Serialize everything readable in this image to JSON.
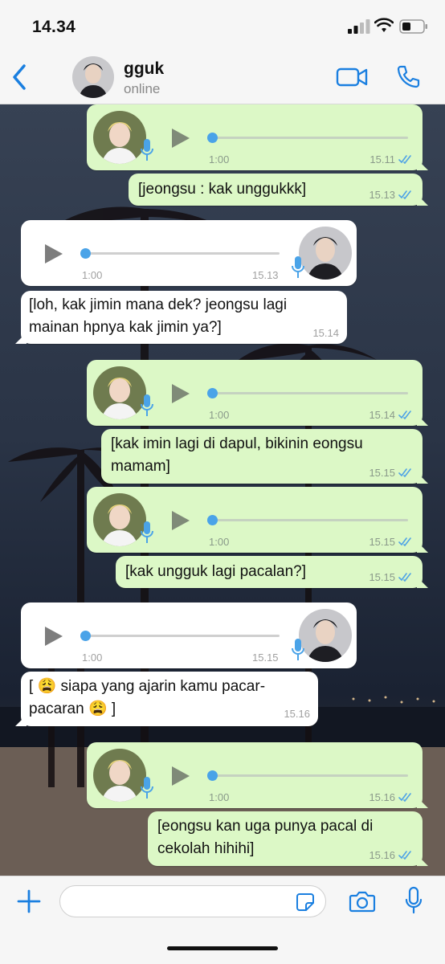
{
  "status_bar": {
    "time": "14.34"
  },
  "header": {
    "contact_name": "gguk",
    "contact_status": "online"
  },
  "messages": [
    {
      "type": "voice",
      "direction": "outgoing",
      "duration": "1:00",
      "time": "15.11",
      "read": true
    },
    {
      "type": "text",
      "direction": "outgoing",
      "lines": [
        "[jeongsu : kak unggukkk]"
      ],
      "time": "15.13",
      "read": true
    },
    {
      "type": "voice",
      "direction": "incoming",
      "duration": "1:00",
      "time": "15.13"
    },
    {
      "type": "text",
      "direction": "incoming",
      "lines": [
        "[loh, kak jimin mana dek? jeongsu lagi",
        "mainan hpnya kak jimin ya?]"
      ],
      "time": "15.14"
    },
    {
      "type": "voice",
      "direction": "outgoing",
      "duration": "1:00",
      "time": "15.14",
      "read": true
    },
    {
      "type": "text",
      "direction": "outgoing",
      "lines": [
        "[kak imin lagi di dapul, bikinin eongsu",
        "mamam]"
      ],
      "time": "15.15",
      "read": true
    },
    {
      "type": "voice",
      "direction": "outgoing",
      "duration": "1:00",
      "time": "15.15",
      "read": true
    },
    {
      "type": "text",
      "direction": "outgoing",
      "lines": [
        "[kak ungguk lagi pacalan?]"
      ],
      "time": "15.15",
      "read": true
    },
    {
      "type": "voice",
      "direction": "incoming",
      "duration": "1:00",
      "time": "15.15"
    },
    {
      "type": "text",
      "direction": "incoming",
      "lines": [
        "[ 😩 siapa yang ajarin kamu pacar-",
        "pacaran 😩 ]"
      ],
      "time": "15.16"
    },
    {
      "type": "voice",
      "direction": "outgoing",
      "duration": "1:00",
      "time": "15.16",
      "read": true
    },
    {
      "type": "text",
      "direction": "outgoing",
      "lines": [
        "[eongsu kan uga punya pacal di",
        "cekolah hihihi]"
      ],
      "time": "15.16",
      "read": true
    }
  ],
  "composer": {
    "placeholder": "",
    "value": ""
  },
  "icons": {
    "back": "chevron-left-icon",
    "video": "video-camera-icon",
    "call": "phone-icon",
    "plus": "plus-icon",
    "sticker": "sticker-icon",
    "camera": "camera-icon",
    "mic": "microphone-icon"
  },
  "colors": {
    "accent": "#1a7fe0",
    "outgoing_bubble": "#dcf8c6",
    "incoming_bubble": "#ffffff",
    "read_ticks": "#4fa3e6",
    "progress_dot": "#4aa3e8"
  }
}
